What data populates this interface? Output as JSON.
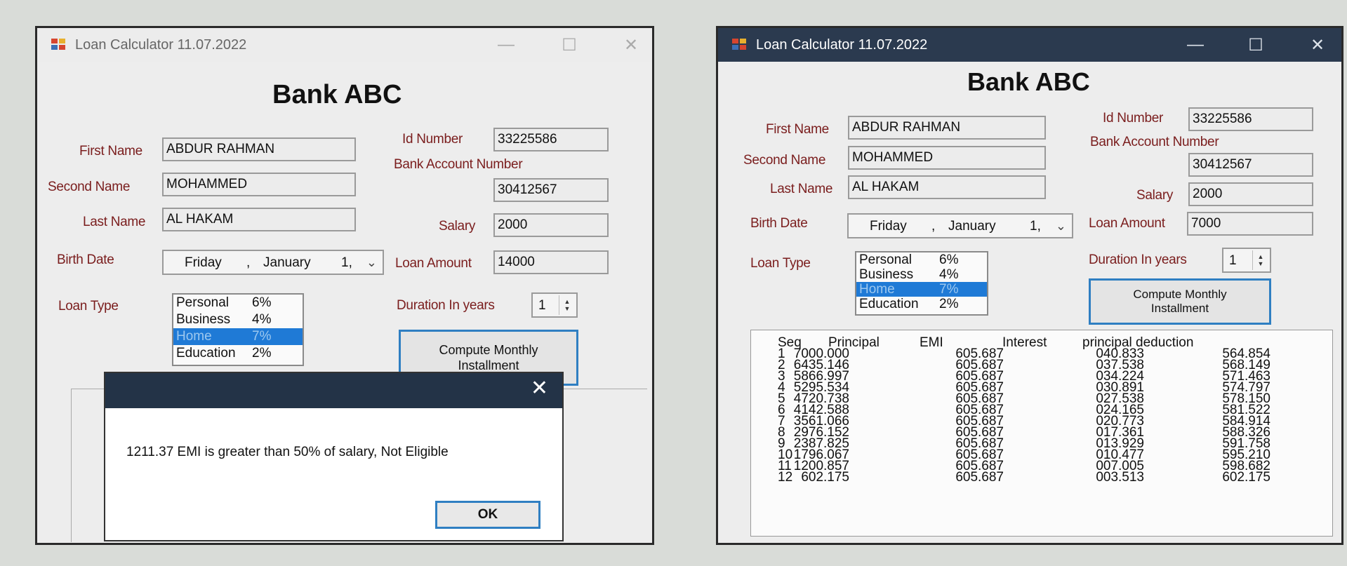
{
  "app": {
    "title": "Loan Calculator  11.07.2022",
    "bank_name": "Bank ABC"
  },
  "labels": {
    "first_name": "First Name",
    "second_name": "Second Name",
    "last_name": "Last Name",
    "birth_date": "Birth Date",
    "loan_type": "Loan Type",
    "id_number": "Id Number",
    "bank_account": "Bank Account Number",
    "salary": "Salary",
    "loan_amount": "Loan Amount",
    "duration": "Duration In years",
    "compute": "Compute Monthly Installment"
  },
  "date_parts": {
    "day_name": "Friday",
    "sep": ",",
    "month": "January",
    "day": "1,"
  },
  "loan_types": [
    {
      "name": "Personal",
      "rate": "6%"
    },
    {
      "name": "Business",
      "rate": "4%"
    },
    {
      "name": "Home",
      "rate": "7%"
    },
    {
      "name": "Education",
      "rate": "2%"
    }
  ],
  "selected_loan_type": "Home",
  "window_left": {
    "first_name": "ABDUR RAHMAN",
    "second_name": "MOHAMMED",
    "last_name": "AL HAKAM",
    "id_number": "33225586",
    "bank_account": "30412567",
    "salary": "2000",
    "loan_amount": "14000",
    "duration": "1"
  },
  "dialog": {
    "message": "1211.37  EMI is greater than 50% of salary, Not Eligible",
    "ok": "OK"
  },
  "window_right": {
    "first_name": "ABDUR RAHMAN",
    "second_name": "MOHAMMED",
    "last_name": "AL HAKAM",
    "id_number": "33225586",
    "bank_account": "30412567",
    "salary": "2000",
    "loan_amount": "7000",
    "duration": "1"
  },
  "schedule": {
    "headers": [
      "Seq",
      "Principal",
      "EMI",
      "Interest",
      "principal deduction"
    ],
    "rows": [
      [
        "1",
        "7000.000",
        "605.687",
        "040.833",
        "564.854"
      ],
      [
        "2",
        "6435.146",
        "605.687",
        "037.538",
        "568.149"
      ],
      [
        "3",
        "5866.997",
        "605.687",
        "034.224",
        "571.463"
      ],
      [
        "4",
        "5295.534",
        "605.687",
        "030.891",
        "574.797"
      ],
      [
        "5",
        "4720.738",
        "605.687",
        "027.538",
        "578.150"
      ],
      [
        "6",
        "4142.588",
        "605.687",
        "024.165",
        "581.522"
      ],
      [
        "7",
        "3561.066",
        "605.687",
        "020.773",
        "584.914"
      ],
      [
        "8",
        "2976.152",
        "605.687",
        "017.361",
        "588.326"
      ],
      [
        "9",
        "2387.825",
        "605.687",
        "013.929",
        "591.758"
      ],
      [
        "10",
        "1796.067",
        "605.687",
        "010.477",
        "595.210"
      ],
      [
        "11",
        "1200.857",
        "605.687",
        "007.005",
        "598.682"
      ],
      [
        "12",
        "602.175",
        "605.687",
        "003.513",
        "602.175"
      ]
    ]
  }
}
